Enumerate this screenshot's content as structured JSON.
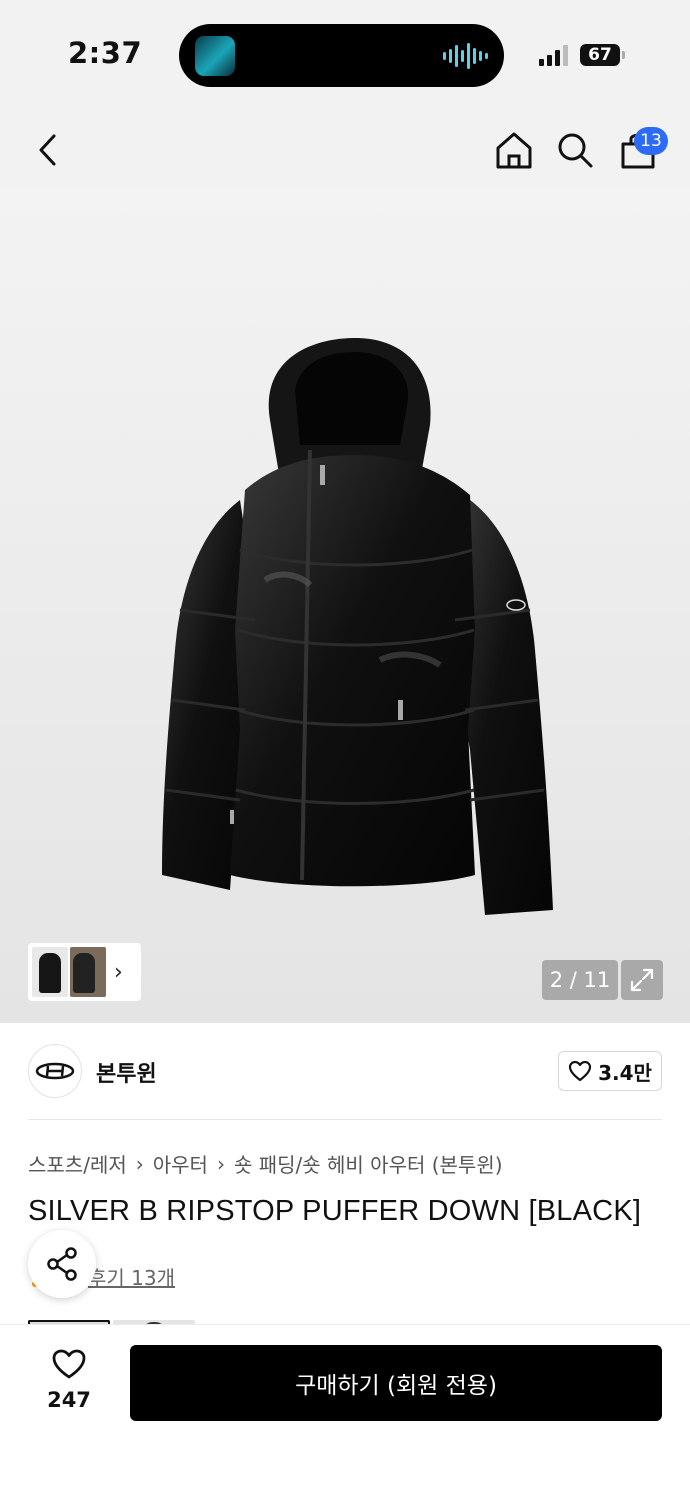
{
  "status_bar": {
    "time": "2:37",
    "battery": "67"
  },
  "header": {
    "cart_count": "13"
  },
  "gallery": {
    "counter": "2 / 11"
  },
  "brand": {
    "name": "본투윈",
    "likes": "3.4만"
  },
  "breadcrumb": [
    "스포츠/레저",
    "아우터",
    "숏 패딩/숏 헤비 아우터 (본투윈)"
  ],
  "product": {
    "title": "SILVER B RIPSTOP PUFFER DOWN [BLACK]",
    "reviews": "후기 13개"
  },
  "bottom_bar": {
    "wish_count": "247",
    "buy_label": "구매하기 (회원 전용)"
  },
  "colors": {
    "accent_blue": "#2c6bf5",
    "buy_bg": "#000000",
    "star": "#f3a300"
  },
  "icons": [
    "back-arrow-icon",
    "home-icon",
    "search-icon",
    "shopping-bag-icon",
    "expand-icon",
    "heart-icon",
    "share-icon",
    "chevron-right-icon"
  ]
}
